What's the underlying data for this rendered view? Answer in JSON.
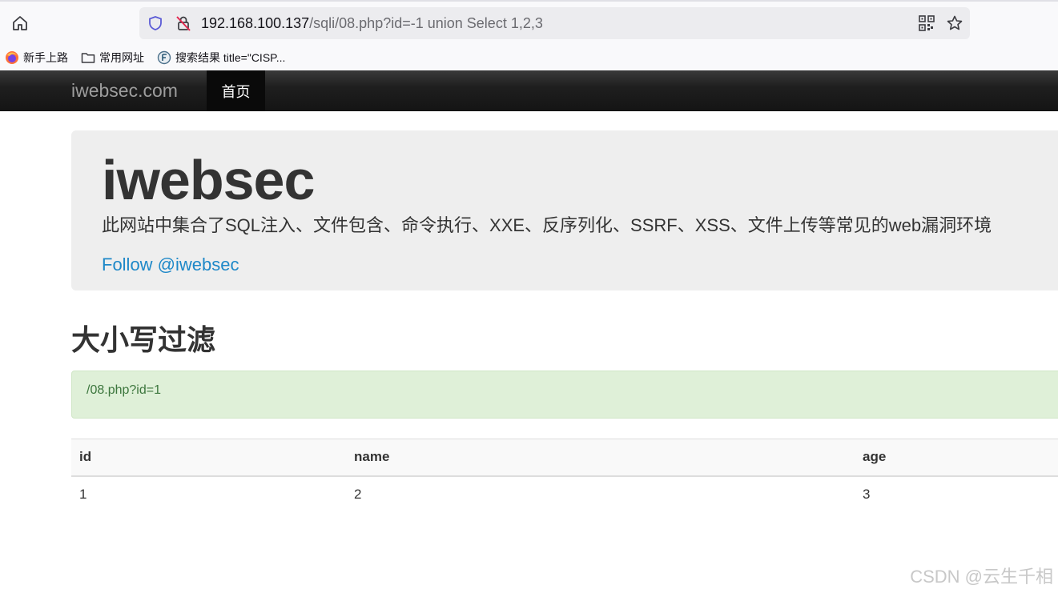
{
  "browser": {
    "url_host": "192.168.100.137",
    "url_path": "/sqli/08.php?id=-1 union Select 1,2,3",
    "bookmarks": [
      {
        "label": "新手上路",
        "icon": "firefox-icon"
      },
      {
        "label": "常用网址",
        "icon": "folder-icon"
      },
      {
        "label": "搜索结果 title=\"CISP...",
        "icon": "site-favicon-icon"
      }
    ]
  },
  "navbar": {
    "brand": "iwebsec.com",
    "home": "首页"
  },
  "jumbotron": {
    "title": "iwebsec",
    "description": "此网站中集合了SQL注入、文件包含、命令执行、XXE、反序列化、SSRF、XSS、文件上传等常见的web漏洞环境",
    "follow_link": "Follow @iwebsec"
  },
  "section": {
    "title": "大小写过滤",
    "alert": "/08.php?id=1"
  },
  "table": {
    "headers": [
      "id",
      "name",
      "age"
    ],
    "rows": [
      [
        "1",
        "2",
        "3"
      ]
    ]
  },
  "watermark": "CSDN @云生千相",
  "colors": {
    "navbar_bg": "#141414",
    "jumbotron_bg": "#eeeeee",
    "link": "#1e88c8",
    "alert_bg": "#dff0d8",
    "alert_text": "#3c763d"
  }
}
